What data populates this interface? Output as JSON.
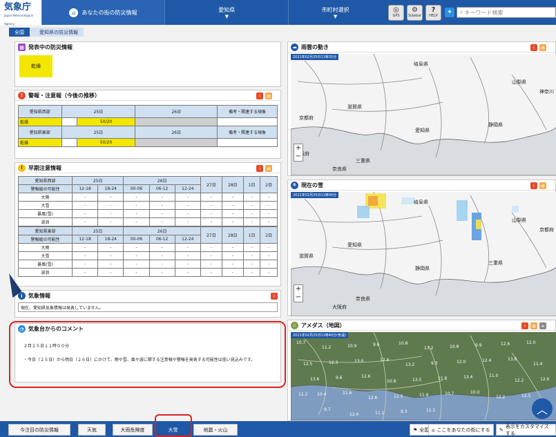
{
  "header": {
    "logo_text": "気象庁",
    "logo_sub": "Japan Meteorological Agency",
    "nav": [
      {
        "label": "あなたの街の防災情報"
      },
      {
        "label": "愛知県"
      },
      {
        "label": "市町村選択"
      }
    ],
    "tools": [
      "GPS",
      "Sidebar",
      "HELP"
    ],
    "search_placeholder": "キーワード検索"
  },
  "breadcrumb": [
    "全国",
    "愛知県の防災情報"
  ],
  "active_info": {
    "title": "発表中の防災情報",
    "badge": "乾燥",
    "badge_color": "#f3e600"
  },
  "warnings": {
    "title": "警報・注意報（今後の推移）",
    "regions": [
      {
        "name": "愛知県西部",
        "day1": "25日",
        "day2": "26日",
        "remark": "備考・関連する現象",
        "row_label": "乾燥",
        "value": "50/20"
      },
      {
        "name": "愛知県東部",
        "day1": "25日",
        "day2": "26日",
        "remark": "備考・関連する現象",
        "row_label": "乾燥",
        "value": "50/20"
      }
    ]
  },
  "early": {
    "title": "早期注意情報",
    "blocks": [
      {
        "region": "愛知県西部",
        "prob": "警報級の可能性",
        "d1": "25日",
        "d2": "26日",
        "cols": [
          "12-18",
          "18-24",
          "00-06",
          "06-12",
          "12-24"
        ],
        "later": [
          "27日",
          "28日",
          "1日",
          "2日"
        ],
        "rows": [
          "大雨",
          "大雪",
          "暴風(雪)",
          "波浪"
        ]
      },
      {
        "region": "愛知県東部",
        "prob": "警報級の可能性",
        "d1": "25日",
        "d2": "26日",
        "cols": [
          "12-18",
          "18-24",
          "00-06",
          "06-12",
          "12-24"
        ],
        "later": [
          "27日",
          "28日",
          "1日",
          "2日"
        ],
        "rows": [
          "大雨",
          "大雪",
          "暴風(雪)",
          "波浪"
        ]
      }
    ],
    "dash": "-"
  },
  "weather_info": {
    "title": "気象情報",
    "text": "現在、愛知県気象情報は発表していません。"
  },
  "comment": {
    "title": "気象台からのコメント",
    "time": "２月２５日１１時００分",
    "body": "・今日（２５日）から明日（２６日）にかけて、雨や雪、風や波に関する注意報や警報を発表する可能性は低い見込みです。"
  },
  "maps": {
    "rain": {
      "title": "雨雲の動き",
      "stamp": "2021年02月25日11時35分",
      "labels": [
        "岐阜県",
        "山梨県",
        "神奈川",
        "京都府",
        "滋賀県",
        "愛知県",
        "静岡県",
        "三重県",
        "奈良県",
        "大阪府"
      ]
    },
    "snow": {
      "title": "現在の雪",
      "stamp": "2021年02月25日11時00分",
      "labels": [
        "岐阜県",
        "山梨県",
        "京都府",
        "滋賀県",
        "愛知県",
        "静岡県",
        "三重県",
        "奈良県",
        "大阪府"
      ]
    },
    "amedas": {
      "title": "アメダス（地図）",
      "stamp": "2021年02月25日11時40分(気温)",
      "values": [
        "10.7",
        "11.2",
        "10.9",
        "9.6",
        "10.8",
        "13.2",
        "10.8",
        "9.9",
        "12.6",
        "12.0",
        "12.5",
        "12.3",
        "13.0",
        "12.4",
        "13.2",
        "9.3",
        "12.0",
        "12.4",
        "13.8",
        "11.4",
        "13.6",
        "9.6",
        "12.6",
        "10.8",
        "13.5",
        "11.8",
        "13.4",
        "11.0",
        "12.2",
        "12.6",
        "10.4",
        "11.6",
        "12.6",
        "12.5",
        "11.9",
        "10.7",
        "10.0",
        "12.2",
        "12.5",
        "11.3",
        "9.7",
        "12.4",
        "11.1",
        "9.3",
        "11.1"
      ]
    }
  },
  "bottom": {
    "tabs": [
      "今注目の防災情報",
      "天気",
      "大雨危険度",
      "大雪",
      "地震・火山"
    ],
    "active": "大雪",
    "right": [
      "全国",
      "ここをあなたの街にする",
      "表示をカスタマイズする"
    ]
  }
}
